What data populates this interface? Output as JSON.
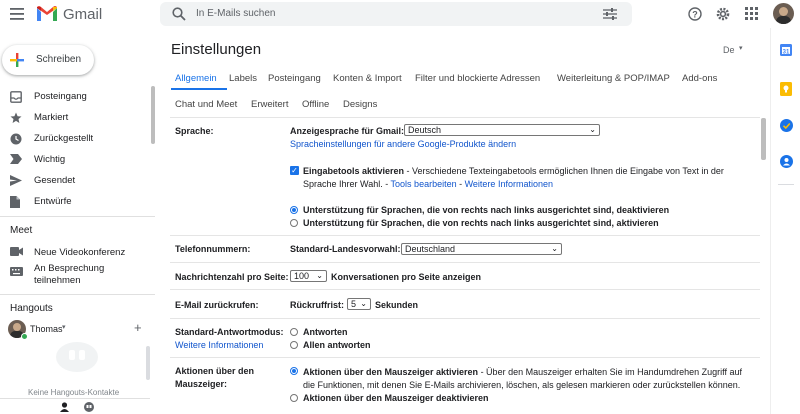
{
  "header": {
    "app_name": "Gmail",
    "search_placeholder": "In E-Mails suchen"
  },
  "sidebar": {
    "compose_label": "Schreiben",
    "items": [
      {
        "label": "Posteingang"
      },
      {
        "label": "Markiert"
      },
      {
        "label": "Zurückgestellt"
      },
      {
        "label": "Wichtig"
      },
      {
        "label": "Gesendet"
      },
      {
        "label": "Entwürfe"
      }
    ],
    "meet": {
      "title": "Meet",
      "new_meeting": "Neue Videokonferenz",
      "join_line1": "An Besprechung",
      "join_line2": "teilnehmen"
    },
    "hangouts": {
      "title": "Hangouts",
      "user": "Thomas",
      "empty_text": "Keine Hangouts-Kontakte"
    }
  },
  "settings": {
    "title": "Einstellungen",
    "lang_badge": "De",
    "tabs_row1": [
      "Allgemein",
      "Labels",
      "Posteingang",
      "Konten & Import",
      "Filter und blockierte Adressen",
      "Weiterleitung & POP/IMAP",
      "Add-ons"
    ],
    "tabs_row2": [
      "Chat und Meet",
      "Erweitert",
      "Offline",
      "Designs"
    ],
    "sprache": {
      "label": "Sprache:",
      "display_label": "Anzeigesprache für Gmail:",
      "display_value": "Deutsch",
      "other_products_link": "Spracheinstellungen für andere Google-Produkte ändern",
      "input_tools_bold": "Eingabetools aktivieren",
      "input_tools_text": " - Verschiedene Texteingabetools ermöglichen Ihnen die Eingabe von Text in der",
      "input_tools_text2": "Sprache Ihrer Wahl. - ",
      "edit_tools_link": "Tools bearbeiten",
      "sep": " - ",
      "more_info_link": "Weitere Informationen",
      "rtl_off": "Unterstützung für Sprachen, die von rechts nach links ausgerichtet sind, deaktivieren",
      "rtl_on": "Unterstützung für Sprachen, die von rechts nach links ausgerichtet sind, aktivieren"
    },
    "phone": {
      "label": "Telefonnummern:",
      "country_label": "Standard-Landesvorwahl:",
      "country_value": "Deutschland"
    },
    "page_size": {
      "label": "Nachrichtenzahl pro Seite:",
      "value": "100",
      "suffix": "Konversationen pro Seite anzeigen"
    },
    "undo": {
      "label": "E-Mail zurückrufen:",
      "period_label": "Rückruffrist:",
      "value": "5",
      "suffix": "Sekunden"
    },
    "reply": {
      "label": "Standard-Antwortmodus:",
      "more_info_link": "Weitere Informationen",
      "opt1": "Antworten",
      "opt2": "Allen antworten"
    },
    "hover": {
      "label_line1": "Aktionen über den",
      "label_line2": "Mauszeiger:",
      "on_bold": "Aktionen über den Mauszeiger aktivieren",
      "on_text": " - Über den Mauszeiger erhalten Sie im Handumdrehen Zugriff auf",
      "on_text2": "die Funktionen, mit denen Sie E-Mails archivieren, löschen, als gelesen markieren oder zurückstellen können.",
      "off_bold": "Aktionen über den Mauszeiger deaktivieren"
    }
  },
  "colors": {
    "accent": "#1a73e8",
    "link": "#1155cc"
  }
}
